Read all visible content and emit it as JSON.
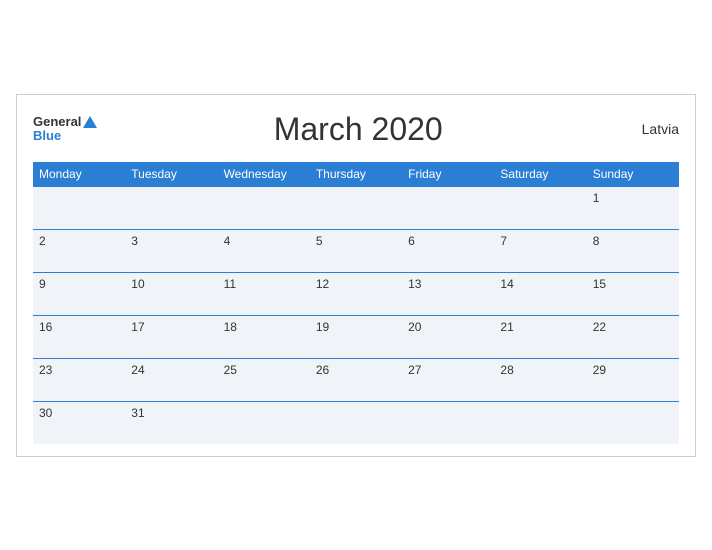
{
  "header": {
    "logo_general": "General",
    "logo_blue": "Blue",
    "title": "March 2020",
    "country": "Latvia"
  },
  "days": [
    "Monday",
    "Tuesday",
    "Wednesday",
    "Thursday",
    "Friday",
    "Saturday",
    "Sunday"
  ],
  "weeks": [
    [
      "",
      "",
      "",
      "",
      "",
      "",
      "1"
    ],
    [
      "2",
      "3",
      "4",
      "5",
      "6",
      "7",
      "8"
    ],
    [
      "9",
      "10",
      "11",
      "12",
      "13",
      "14",
      "15"
    ],
    [
      "16",
      "17",
      "18",
      "19",
      "20",
      "21",
      "22"
    ],
    [
      "23",
      "24",
      "25",
      "26",
      "27",
      "28",
      "29"
    ],
    [
      "30",
      "31",
      "",
      "",
      "",
      "",
      ""
    ]
  ]
}
